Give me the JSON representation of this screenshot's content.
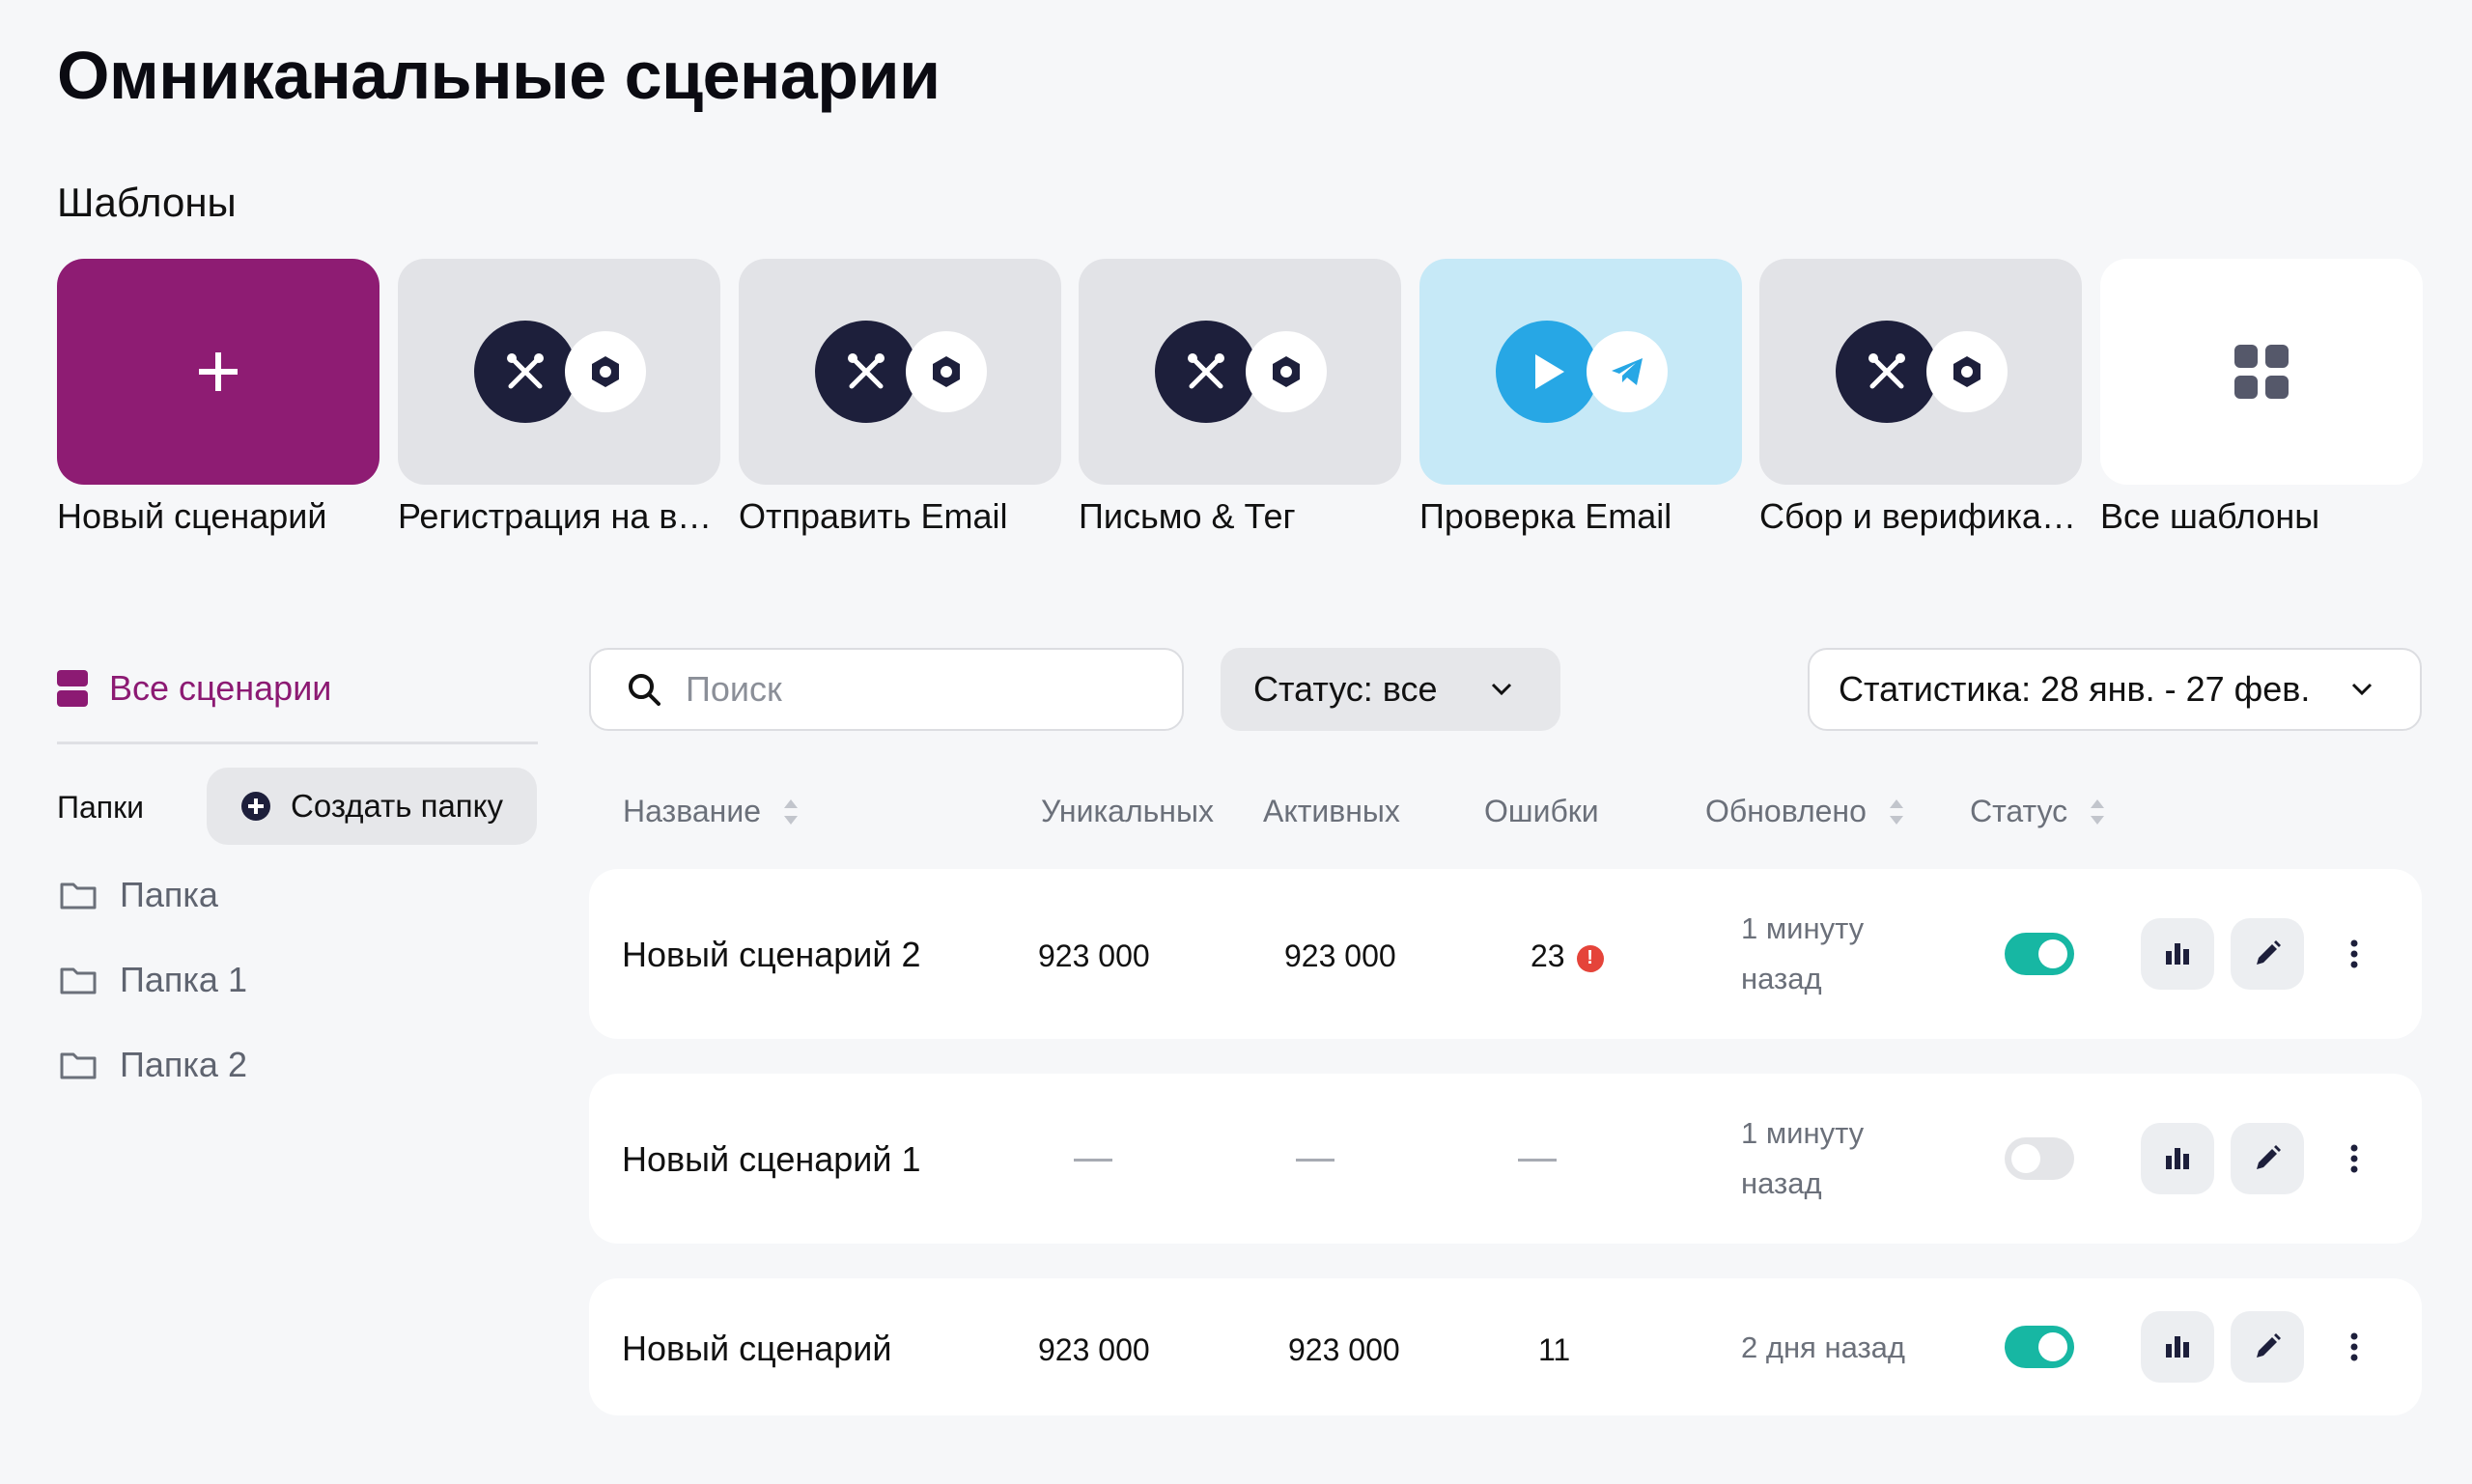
{
  "page": {
    "title": "Омниканальные сценарии"
  },
  "templates": {
    "section_title": "Шаблоны",
    "items": [
      {
        "label": "Новый сценарий",
        "icon": "plus-icon",
        "color": "#8e1c73"
      },
      {
        "label": "Регистрация на вебинар",
        "icon": "tools-icon"
      },
      {
        "label": "Отправить Email",
        "icon": "tools-icon"
      },
      {
        "label": "Письмо & Тег",
        "icon": "tools-icon"
      },
      {
        "label": "Проверка Email",
        "icon": "play-icon",
        "color": "#c6e9f7"
      },
      {
        "label": "Сбор и верификация",
        "icon": "tools-icon"
      },
      {
        "label": "Все шаблоны",
        "icon": "grid-icon"
      }
    ]
  },
  "sidebar": {
    "all_scenarios": "Все сценарии",
    "folders_title": "Папки",
    "create_folder": "Создать папку",
    "folders": [
      "Папка",
      "Папка 1",
      "Папка 2"
    ]
  },
  "toolbar": {
    "search_placeholder": "Поиск",
    "status_filter": "Статус: все",
    "stats_filter": "Статистика: 28 янв. - 27 фев."
  },
  "table": {
    "columns": {
      "name": "Название",
      "unique": "Уникальных",
      "active": "Активных",
      "errors": "Ошибки",
      "updated": "Обновлено",
      "status": "Статус"
    },
    "rows": [
      {
        "name": "Новый сценарий 2",
        "unique": "923 000",
        "active": "923 000",
        "errors": "23",
        "error_badge": "!",
        "updated_1": "1 минуту",
        "updated_2": "назад",
        "enabled": true
      },
      {
        "name": "Новый сценарий 1",
        "unique": "",
        "active": "",
        "errors": "",
        "updated_1": "1 минуту",
        "updated_2": "назад",
        "enabled": false
      },
      {
        "name": "Новый сценарий",
        "unique": "923 000",
        "active": "923 000",
        "errors": "11",
        "updated_1": "2 дня назад",
        "updated_2": "",
        "enabled": true
      }
    ]
  },
  "colors": {
    "accent": "#8e1c73",
    "toggle_on": "#17b7a3",
    "error": "#e5443a",
    "navy": "#1d1f3b",
    "telegram": "#27a7e5"
  }
}
